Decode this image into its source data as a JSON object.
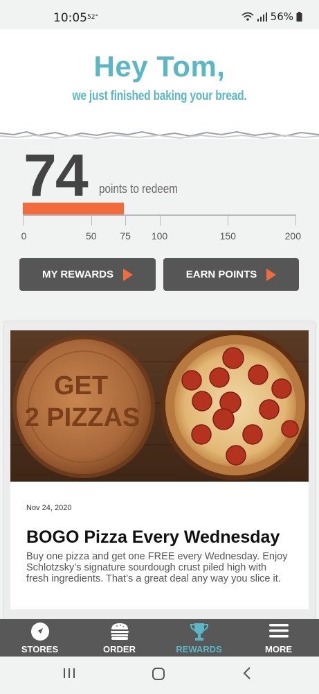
{
  "status_bar": {
    "time": "10:05",
    "temperature": "52°",
    "battery": "56%",
    "icons": [
      "wifi-icon",
      "signal-icon",
      "battery-icon"
    ]
  },
  "header": {
    "greeting": "Hey Tom,",
    "message": "we just finished baking your bread."
  },
  "points": {
    "value": "74",
    "label": "points to redeem",
    "progress_value": 74,
    "progress_max": 200,
    "ticks": [
      "0",
      "50",
      "75",
      "100",
      "150",
      "200"
    ]
  },
  "actions": {
    "my_rewards": "MY REWARDS",
    "earn_points": "EARN POINTS"
  },
  "news_card": {
    "image_text_line1": "GET",
    "image_text_line2": "2 PIZZAS",
    "date": "Nov 24, 2020",
    "title": "BOGO Pizza Every Wednesday",
    "body": "Buy one pizza and get one FREE every Wednesday. Enjoy Schlotzsky’s signature sourdough crust piled high with fresh ingredients.  That’s a great deal any way you slice it."
  },
  "tabs": [
    {
      "label": "STORES",
      "icon": "compass-icon"
    },
    {
      "label": "ORDER",
      "icon": "burger-icon"
    },
    {
      "label": "REWARDS",
      "icon": "trophy-icon",
      "active": true
    },
    {
      "label": "MORE",
      "icon": "menu-icon"
    }
  ],
  "colors": {
    "accent_teal": "#5ab7c4",
    "accent_orange": "#f26b3a",
    "dark_gray": "#565656"
  }
}
